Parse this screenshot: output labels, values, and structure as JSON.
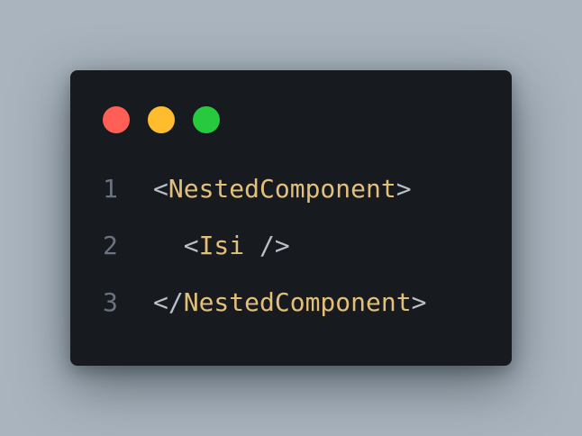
{
  "window": {
    "controls": {
      "close": {
        "name": "close-dot",
        "color": "#ff5f56"
      },
      "minimize": {
        "name": "minimize-dot",
        "color": "#ffbd2e"
      },
      "maximize": {
        "name": "maximize-dot",
        "color": "#27c93f"
      }
    }
  },
  "colors": {
    "background": "#a9b4be",
    "window": "#171a1f",
    "line_number": "#6b7380",
    "punctuation": "#b8c0ca",
    "component": "#e3c07a"
  },
  "code": {
    "lines": [
      {
        "number": "1",
        "indent": "",
        "open": "<",
        "name": "NestedComponent",
        "close": ">"
      },
      {
        "number": "2",
        "indent": "  ",
        "open": "<",
        "name": "Isi",
        "close": " />"
      },
      {
        "number": "3",
        "indent": "",
        "open": "</",
        "name": "NestedComponent",
        "close": ">"
      }
    ]
  }
}
